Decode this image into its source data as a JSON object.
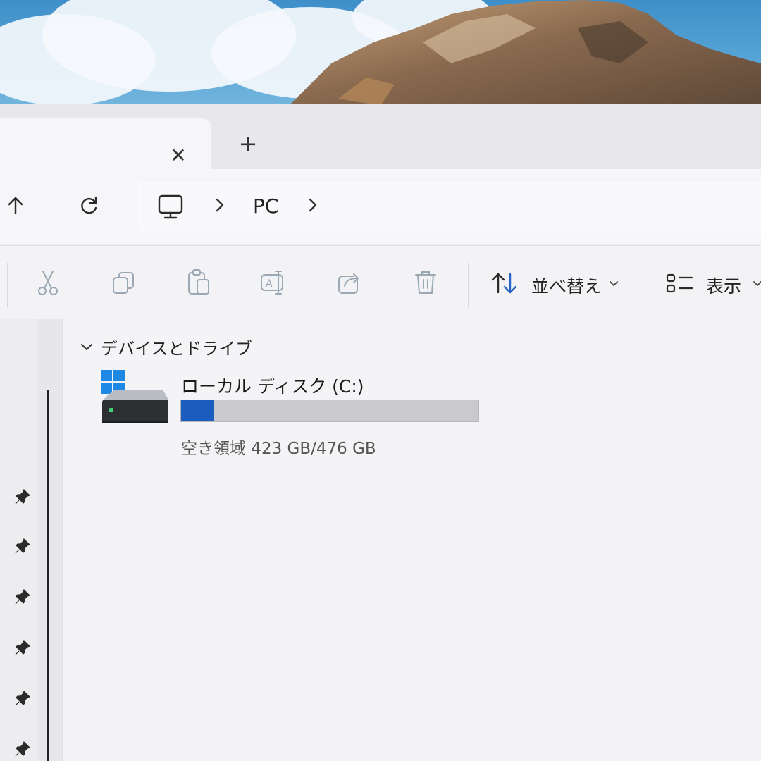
{
  "tabs": {
    "close_glyph": "✕",
    "new_glyph": "+"
  },
  "breadcrumb": {
    "items": [
      "PC"
    ]
  },
  "toolbar": {
    "sort_label": "並べ替え",
    "view_label": "表示"
  },
  "group": {
    "title": "デバイスとドライブ"
  },
  "drive": {
    "name": "ローカル ディスク (C:)",
    "free_text": "空き領域 423 GB/476 GB",
    "free_gb": 423,
    "total_gb": 476,
    "used_fraction": 0.111
  },
  "colors": {
    "accent": "#1b5cbf",
    "bar_track": "#c9c9ce",
    "windows_blue": "#1e88e5"
  }
}
